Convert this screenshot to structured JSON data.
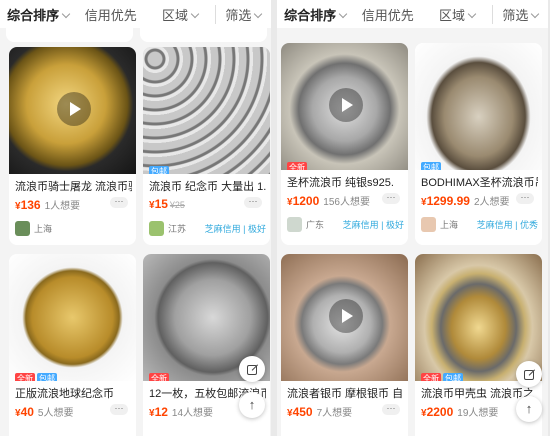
{
  "left": {
    "filters": {
      "sort": "综合排序",
      "credit": "信用优先",
      "area": "区域",
      "screen": "筛选"
    },
    "cards": [
      {
        "title": "流浪币骑士屠龙 流浪币骑",
        "price": "136",
        "want": "1人想要",
        "old": "",
        "city": "上海",
        "credit": ""
      },
      {
        "title": "流浪币 纪念币 大量出 1.",
        "price": "15",
        "want": "",
        "old": "¥25",
        "city": "江苏",
        "credit": "芝麻信用 | 极好",
        "tag": "包邮"
      },
      {
        "title": "正版流浪地球纪念币",
        "price": "40",
        "want": "5人想要",
        "tag": "全新",
        "tag2": "包邮"
      },
      {
        "title": "12一枚，五枚包邮流浪币",
        "price": "12",
        "want": "14人想要",
        "tag": "全新"
      }
    ]
  },
  "right": {
    "filters": {
      "sort": "综合排序",
      "credit": "信用优先",
      "area": "区域",
      "screen": "筛选"
    },
    "cards": [
      {
        "title": "圣杯流浪币 纯银s925.",
        "price": "1200",
        "want": "156人想要",
        "city": "广东",
        "credit": "芝麻信用 | 极好",
        "tag": "全新"
      },
      {
        "title": "BODHIMAX圣杯流浪币吊",
        "price": "1299.99",
        "want": "2人想要",
        "city": "上海",
        "credit": "芝麻信用 | 优秀",
        "tag": "包邮"
      },
      {
        "title": "流浪者银币 摩根银币 自",
        "price": "450",
        "want": "7人想要"
      },
      {
        "title": "流浪币甲壳虫 流浪币之",
        "price": "2200",
        "want": "19人想要",
        "tag": "全新",
        "tag2": "包邮"
      }
    ]
  },
  "icons": {
    "more": "···",
    "currency": "¥",
    "top": "↑"
  }
}
